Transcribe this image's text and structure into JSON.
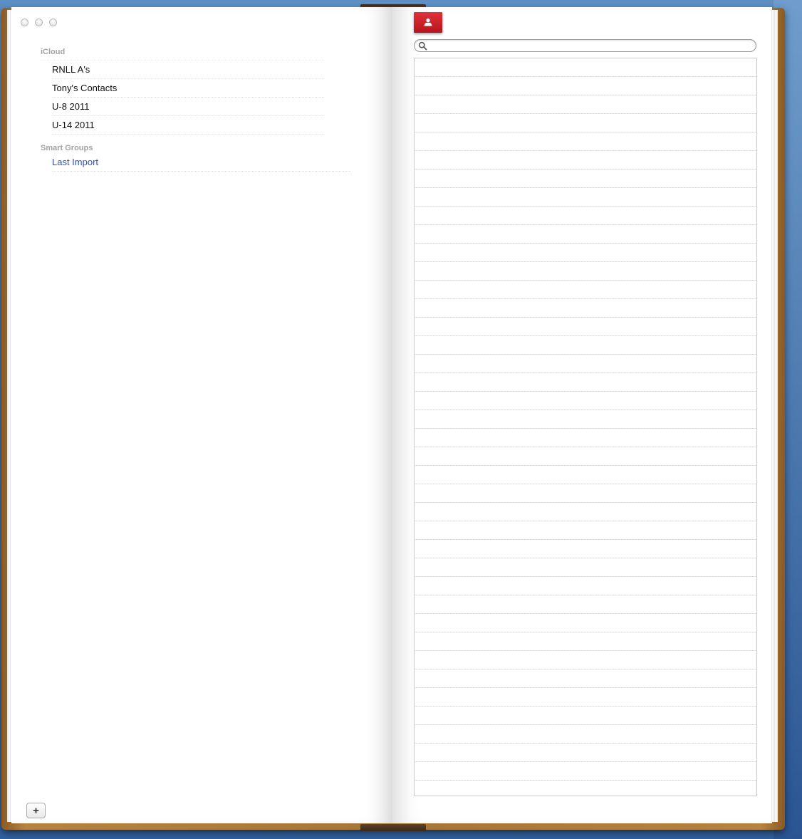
{
  "sidebar": {
    "sections": [
      {
        "header": "iCloud",
        "items": [
          "RNLL A's",
          "Tony's Contacts",
          "U-8 2011",
          "U-14 2011"
        ]
      },
      {
        "header": "Smart Groups",
        "items": [
          "Last Import"
        ]
      }
    ],
    "add_label": "+"
  },
  "toolbar": {
    "bookmark_icon": "person-icon"
  },
  "search": {
    "value": "",
    "placeholder": ""
  },
  "colors": {
    "bookmark": "#c9222b",
    "smart_group_text": "#2d4fb6",
    "section_header": "#a3a3a3"
  }
}
